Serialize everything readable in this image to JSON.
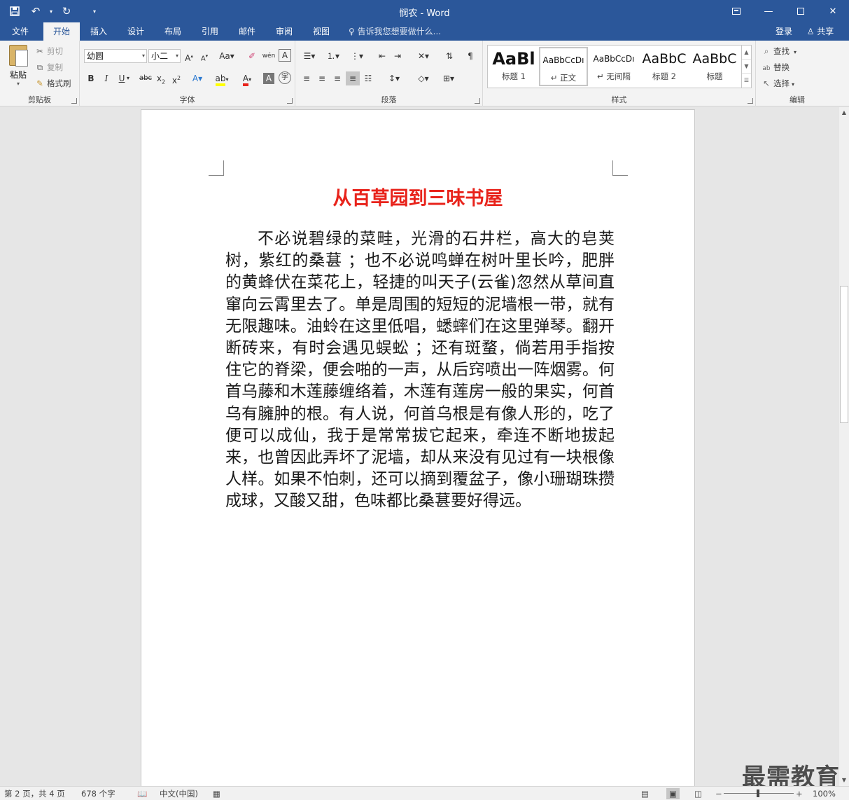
{
  "window": {
    "title": "悯农 - Word",
    "qat": {
      "save_icon": "save-icon",
      "undo_icon": "undo-icon",
      "redo_icon": "redo-icon",
      "customize_icon": "customize-icon"
    },
    "controls": {
      "ribbon_display": "ribbon-display-icon",
      "minimize": "minimize-icon",
      "maximize": "maximize-icon",
      "close": "close-icon"
    }
  },
  "tabs": [
    "文件",
    "开始",
    "插入",
    "设计",
    "布局",
    "引用",
    "邮件",
    "审阅",
    "视图"
  ],
  "active_tab": "开始",
  "tell_me": "告诉我您想要做什么...",
  "account": {
    "login": "登录",
    "share": "共享"
  },
  "clipboard": {
    "label": "剪贴板",
    "paste": "粘贴",
    "cut": "剪切",
    "copy": "复制",
    "format_painter": "格式刷"
  },
  "font": {
    "label": "字体",
    "name": "幼圆",
    "size": "小二",
    "font_color": "#e8231b",
    "highlight_color": "#ffff00"
  },
  "paragraph": {
    "label": "段落"
  },
  "styles": {
    "label": "样式",
    "items": [
      {
        "preview": "AaBl",
        "name": "标题 1"
      },
      {
        "preview": "AaBbCcDı",
        "name": "正文"
      },
      {
        "preview": "AaBbCcDı",
        "name": "无间隔"
      },
      {
        "preview": "AaBbC",
        "name": "标题 2"
      },
      {
        "preview": "AaBbC",
        "name": "标题"
      }
    ],
    "selected": "正文"
  },
  "editing": {
    "label": "编辑",
    "find": "查找",
    "replace": "替换",
    "select": "选择"
  },
  "document": {
    "title": "从百草园到三味书屋",
    "body": "不必说碧绿的菜畦，光滑的石井栏，高大的皂荚树，紫红的桑葚 ；也不必说鸣蝉在树叶里长吟，肥胖的黄蜂伏在菜花上，轻捷的叫天子(云雀)忽然从草间直窜向云霄里去了。单是周围的短短的泥墙根一带，就有无限趣味。油蛉在这里低唱，蟋蟀们在这里弹琴。翻开断砖来，有时会遇见蜈蚣 ；还有斑蝥，倘若用手指按住它的脊梁，便会啪的一声，从后窍喷出一阵烟雾。何首乌藤和木莲藤缠络着，木莲有莲房一般的果实，何首乌有臃肿的根。有人说，何首乌根是有像人形的，吃了便可以成仙，我于是常常拔它起来，牵连不断地拔起来，也曾因此弄坏了泥墙，却从来没有见过有一块根像人样。如果不怕刺，还可以摘到覆盆子，像小珊瑚珠攒成球，又酸又甜，色味都比桑葚要好得远。"
  },
  "watermark": "最需教育",
  "status": {
    "page": "第 2 页，共 4 页",
    "words": "678 个字",
    "language": "中文(中国)",
    "zoom": "100%",
    "zoom_percent": 100
  }
}
